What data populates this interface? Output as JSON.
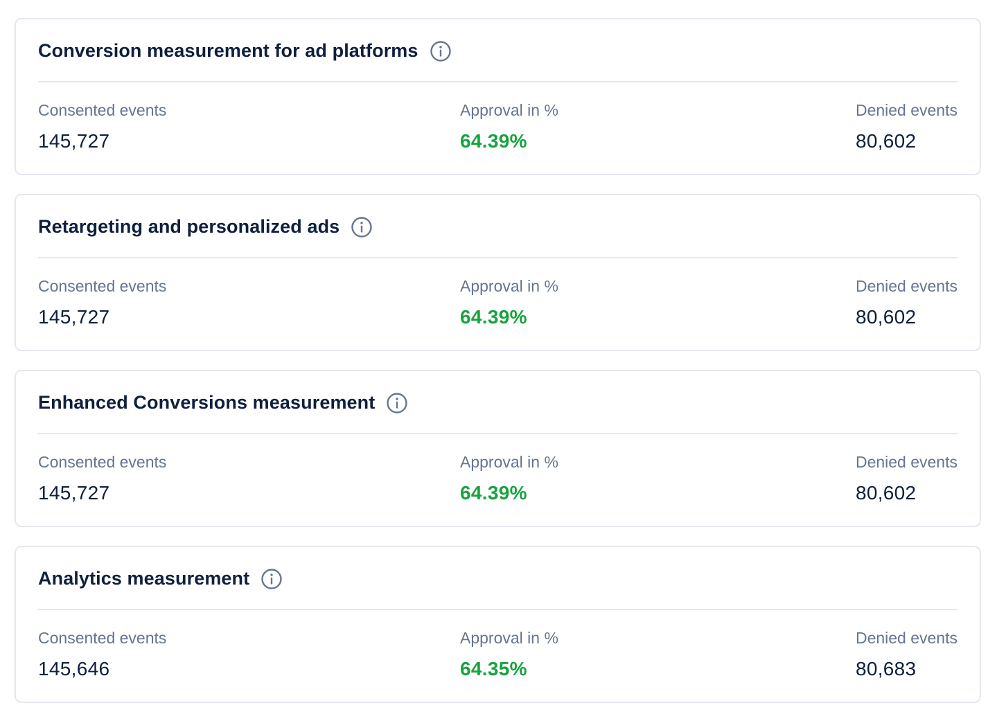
{
  "colors": {
    "title": "#0f1f3d",
    "label": "#66758f",
    "value": "#0f1f3d",
    "approval": "#17a33f",
    "border": "#e3e7ee",
    "icon": "#66758f"
  },
  "cards": [
    {
      "title": "Conversion measurement for ad platforms",
      "icon": "info-icon",
      "consented_label": "Consented events",
      "consented_value": "145,727",
      "approval_label": "Approval in %",
      "approval_value": "64.39%",
      "denied_label": "Denied events",
      "denied_value": "80,602"
    },
    {
      "title": "Retargeting and personalized ads",
      "icon": "info-icon",
      "consented_label": "Consented events",
      "consented_value": "145,727",
      "approval_label": "Approval in %",
      "approval_value": "64.39%",
      "denied_label": "Denied events",
      "denied_value": "80,602"
    },
    {
      "title": "Enhanced Conversions measurement",
      "icon": "info-icon",
      "consented_label": "Consented events",
      "consented_value": "145,727",
      "approval_label": "Approval in %",
      "approval_value": "64.39%",
      "denied_label": "Denied events",
      "denied_value": "80,602"
    },
    {
      "title": "Analytics measurement",
      "icon": "info-icon",
      "consented_label": "Consented events",
      "consented_value": "145,646",
      "approval_label": "Approval in %",
      "approval_value": "64.35%",
      "denied_label": "Denied events",
      "denied_value": "80,683"
    }
  ]
}
